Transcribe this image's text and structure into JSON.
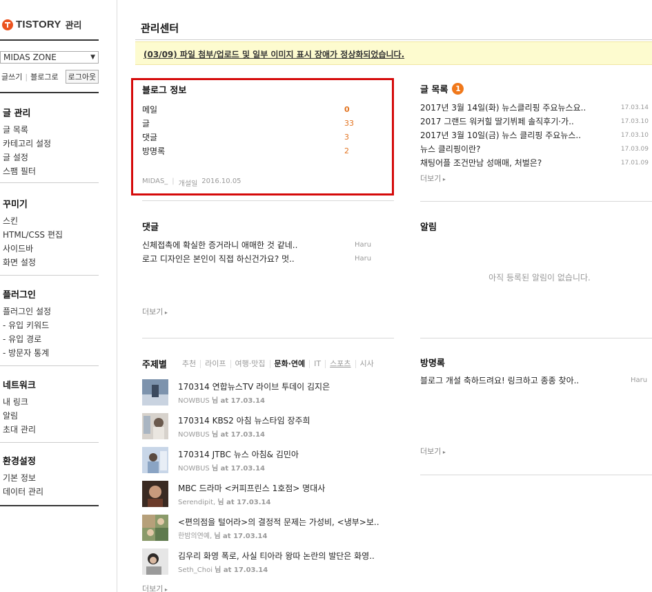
{
  "sidebar": {
    "logo_text": "TISTORY",
    "logo_sub": "관리",
    "blog_select": "MIDAS ZONE",
    "links": {
      "write": "글쓰기",
      "blog": "블로그로",
      "logout": "로그아웃"
    },
    "groups": [
      {
        "title": "글 관리",
        "items": [
          "글 목록",
          "카테고리 설정",
          "글 설정",
          "스팸 필터"
        ]
      },
      {
        "title": "꾸미기",
        "items": [
          "스킨",
          "HTML/CSS 편집",
          "사이드바",
          "화면 설정"
        ]
      },
      {
        "title": "플러그인",
        "items": [
          "플러그인 설정",
          "- 유입 키워드",
          "- 유입 경로",
          "- 방문자 통계"
        ]
      },
      {
        "title": "네트워크",
        "items": [
          "내 링크",
          "알림",
          "초대 관리"
        ]
      },
      {
        "title": "환경설정",
        "items": [
          "기본 정보",
          "데이터 관리"
        ]
      }
    ]
  },
  "main": {
    "title": "관리센터",
    "notice": "(03/09) 파일 첨부/업로드 및 일부 이미지 표시 장애가 정상화되었습니다.",
    "blog_info": {
      "title": "블로그 정보",
      "rows": [
        {
          "label": "메일",
          "value": "0"
        },
        {
          "label": "글",
          "value": "33"
        },
        {
          "label": "댓글",
          "value": "3"
        },
        {
          "label": "방명록",
          "value": "2"
        }
      ],
      "owner": "MIDAS_",
      "opened_label": "개설일",
      "opened_date": "2016.10.05"
    },
    "posts": {
      "title": "글 목록",
      "badge": "1",
      "items": [
        {
          "title": "2017년 3월 14일(화) 뉴스클리핑 주요뉴스요..",
          "date": "17.03.14"
        },
        {
          "title": "2017 그랜드 워커힐 딸기뷔페 솔직후기·가..",
          "date": "17.03.10"
        },
        {
          "title": "2017년 3월 10일(금) 뉴스 클리핑 주요뉴스..",
          "date": "17.03.10"
        },
        {
          "title": "뉴스 클리핑이란?",
          "date": "17.03.09"
        },
        {
          "title": "채팅어플 조건만남 성매매, 처벌은?",
          "date": "17.01.09"
        }
      ],
      "more": "더보기"
    },
    "comments": {
      "title": "댓글",
      "items": [
        {
          "text": "신체접촉에 확실한 증거라니 애매한 것 같네..",
          "author": "Haru"
        },
        {
          "text": "로고 디자인은 본인이 직접 하신건가요? 멋..",
          "author": "Haru"
        }
      ],
      "more": "더보기"
    },
    "alerts": {
      "title": "알림",
      "empty": "아직 등록된 알림이 없습니다."
    },
    "topics": {
      "title": "주제별",
      "tabs": [
        "추천",
        "라이프",
        "여행·맛집",
        "문화·연예",
        "IT",
        "스포츠",
        "시사"
      ],
      "feed": [
        {
          "title": "170314 연합뉴스TV 라이브 투데이 김지은",
          "author": "NOWBUS",
          "suffix": "님 at 17.03.14"
        },
        {
          "title": "170314 KBS2 아침 뉴스타임 장주희",
          "author": "NOWBUS",
          "suffix": "님 at 17.03.14"
        },
        {
          "title": "170314 JTBC 뉴스 아침& 김민아",
          "author": "NOWBUS",
          "suffix": "님 at 17.03.14"
        },
        {
          "title": "MBC 드라마 <커피프린스 1호점> 명대사",
          "author": "Serendipit,",
          "suffix": "님 at 17.03.14"
        },
        {
          "title": "<편의점을 털어라>의 결정적 문제는 가성비, <냉부>보..",
          "author": "한밤의연예,",
          "suffix": "님 at 17.03.14"
        },
        {
          "title": "김우리 화영 폭로, 사실 티아라 왕따 논란의 발단은 화영..",
          "author": "Seth_Choi",
          "suffix": "님 at 17.03.14"
        }
      ],
      "more": "더보기"
    },
    "guestbook": {
      "title": "방명록",
      "items": [
        {
          "text": "블로그 개설 축하드려요! 링크하고 종종 찾아..",
          "author": "Haru"
        }
      ],
      "more": "더보기"
    }
  },
  "colors": {
    "accent": "#eb531f",
    "badge": "#f0781a",
    "highlight_box": "#d50a0a",
    "notice_bg": "#fdfbcf"
  }
}
